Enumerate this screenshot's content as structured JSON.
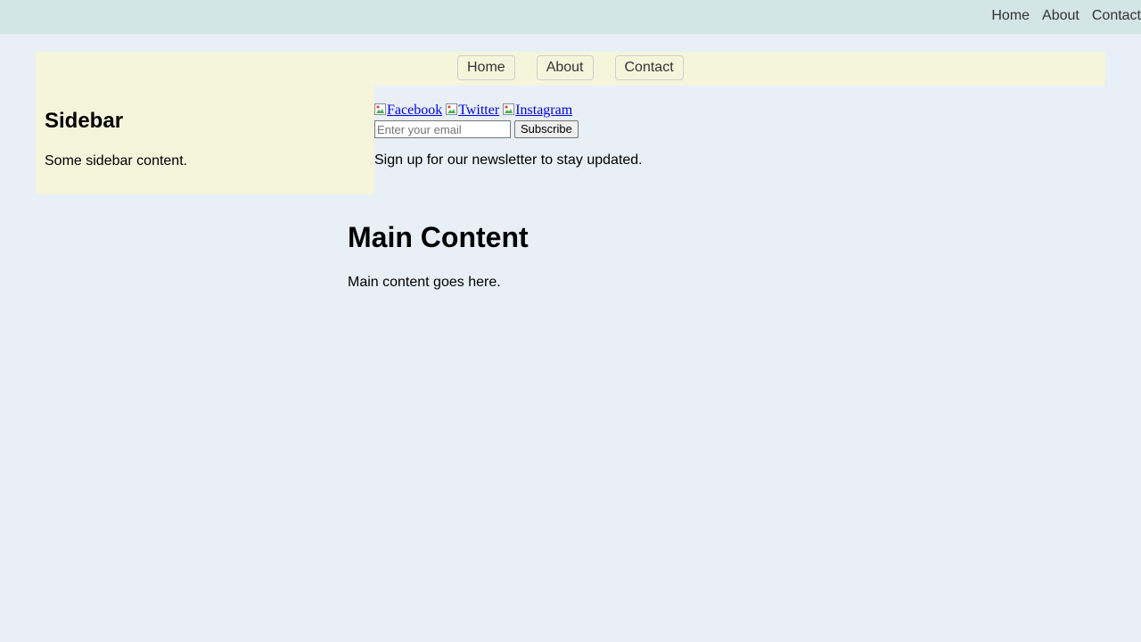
{
  "topbar": {
    "nav": [
      "Home",
      "About",
      "Contact"
    ]
  },
  "secondary_nav": {
    "buttons": [
      "Home",
      "About",
      "Contact"
    ]
  },
  "sidebar": {
    "title": "Sidebar",
    "text": "Some sidebar content."
  },
  "social": {
    "links": [
      "Facebook",
      "Twitter",
      "Instagram"
    ]
  },
  "newsletter": {
    "email_placeholder": "Enter your email",
    "email_value": "",
    "subscribe_label": "Subscribe",
    "text": "Sign up for our newsletter to stay updated."
  },
  "main": {
    "title": "Main Content",
    "text": "Main content goes here."
  },
  "colors": {
    "page_background": "#e8eff6",
    "topbar_background": "#d3e5e4",
    "panel_background": "#f5f5dc",
    "link": "#0000ee"
  },
  "icons": {
    "social_link_image": "broken-image-icon"
  }
}
